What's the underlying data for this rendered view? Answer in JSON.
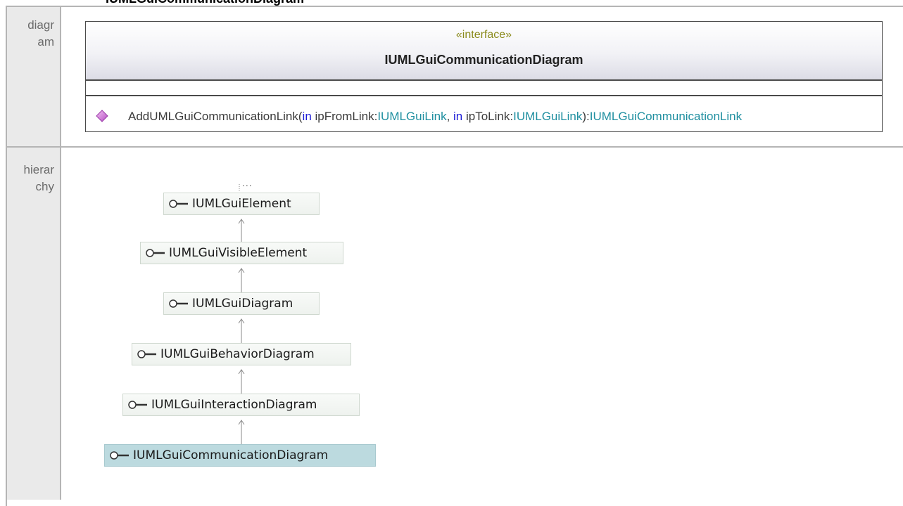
{
  "page_title": "IUMLGuiCommunicationDiagram",
  "labels": {
    "diagram_line1": "diagr",
    "diagram_line2": "am",
    "hierarchy_line1": "hierar",
    "hierarchy_line2": "chy"
  },
  "interface": {
    "stereotype": "«interface»",
    "name": "IUMLGuiCommunicationDiagram",
    "operation": {
      "name": "AddUMLGuiCommunicationLink(",
      "kw1": "in",
      "p1_name": " ipFromLink:",
      "p1_type": "IUMLGuiLink",
      "sep": ", ",
      "kw2": "in",
      "p2_name": " ipToLink:",
      "p2_type": "IUMLGuiLink",
      "close": "):",
      "return_type": "IUMLGuiCommunicationLink"
    }
  },
  "hierarchy": {
    "ellipsis": "...",
    "nodes": [
      {
        "name": "IUMLGuiElement"
      },
      {
        "name": "IUMLGuiVisibleElement"
      },
      {
        "name": "IUMLGuiDiagram"
      },
      {
        "name": "IUMLGuiBehaviorDiagram"
      },
      {
        "name": "IUMLGuiInteractionDiagram"
      },
      {
        "name": "IUMLGuiCommunicationDiagram",
        "selected": true
      }
    ]
  },
  "colors": {
    "keyword": "#1c1cd6",
    "type": "#1f8fa0",
    "stereotype": "#8a8a1a",
    "operation_icon": "#d46ad4",
    "selected_node": "#bcdadf"
  }
}
